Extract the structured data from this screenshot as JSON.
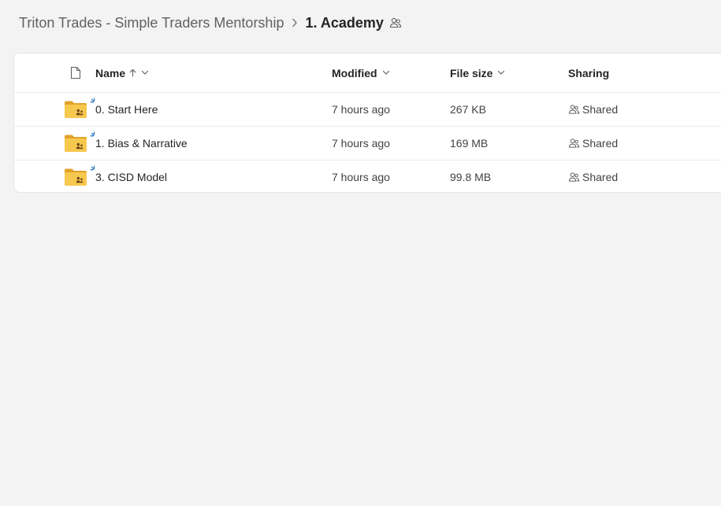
{
  "breadcrumb": {
    "parent": "Triton Trades - Simple Traders Mentorship",
    "current": "1. Academy"
  },
  "columns": {
    "name": "Name",
    "modified": "Modified",
    "file_size": "File size",
    "sharing": "Sharing"
  },
  "files": [
    {
      "name": "0. Start Here",
      "modified": "7 hours ago",
      "size": "267 KB",
      "sharing": "Shared",
      "icon": "shared-folder-icon"
    },
    {
      "name": "1. Bias & Narrative",
      "modified": "7 hours ago",
      "size": "169 MB",
      "sharing": "Shared",
      "icon": "shared-folder-icon"
    },
    {
      "name": "3. CISD Model",
      "modified": "7 hours ago",
      "size": "99.8 MB",
      "sharing": "Shared",
      "icon": "shared-folder-icon"
    }
  ],
  "colors": {
    "folder": "#f5c146",
    "folder_dark": "#e2a22b",
    "new_badge": "#2b78c5",
    "background": "#f3f3f3"
  }
}
